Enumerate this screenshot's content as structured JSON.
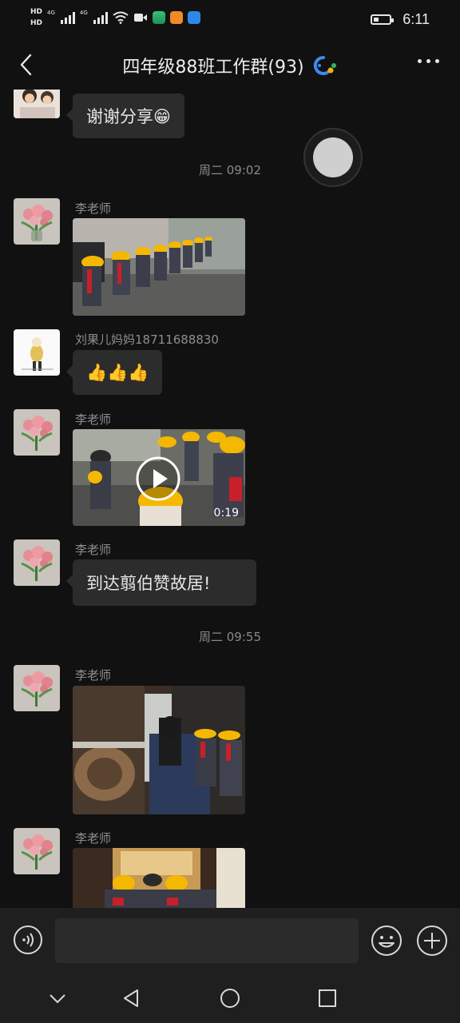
{
  "status_bar": {
    "hd1": "HD",
    "hd2": "HD",
    "net1": "4G",
    "net2": "4G",
    "time": "6:11",
    "icons": [
      "signal-icon",
      "signal-icon",
      "wifi-icon",
      "video-call-icon",
      "green-app-icon",
      "orange-app-icon",
      "blue-cloud-icon",
      "battery-icon"
    ]
  },
  "header": {
    "title": "四年级88班工作群(93)",
    "badge_icon": "group-chat-icon",
    "back_icon": "back-chevron-icon",
    "more_icon": "more-dots-icon"
  },
  "messages": [
    {
      "type": "text",
      "sender": "",
      "text": "谢谢分享😁"
    },
    {
      "type": "time",
      "text": "周二 09:02"
    },
    {
      "type": "image",
      "sender": "李老师",
      "desc": "students in yellow caps"
    },
    {
      "type": "text",
      "sender": "刘果儿妈妈18711688830",
      "text": "👍👍👍"
    },
    {
      "type": "video",
      "sender": "李老师",
      "duration": "0:19"
    },
    {
      "type": "text",
      "sender": "李老师",
      "text": "到达翦伯赞故居!"
    },
    {
      "type": "time",
      "text": "周二 09:55"
    },
    {
      "type": "image",
      "sender": "李老师"
    },
    {
      "type": "image",
      "sender": "李老师"
    }
  ],
  "input_bar": {
    "voice_icon": "voice-input-icon",
    "emoji_icon": "emoji-icon",
    "plus_icon": "plus-icon",
    "value": ""
  },
  "nav_bar": {
    "icons": [
      "nav-hide-icon",
      "nav-back-icon",
      "nav-home-icon",
      "nav-recents-icon"
    ]
  },
  "colors": {
    "background": "#111111",
    "bubble": "#2c2c2c",
    "cap_yellow": "#f5b800",
    "scarf_red": "#c8202a"
  }
}
